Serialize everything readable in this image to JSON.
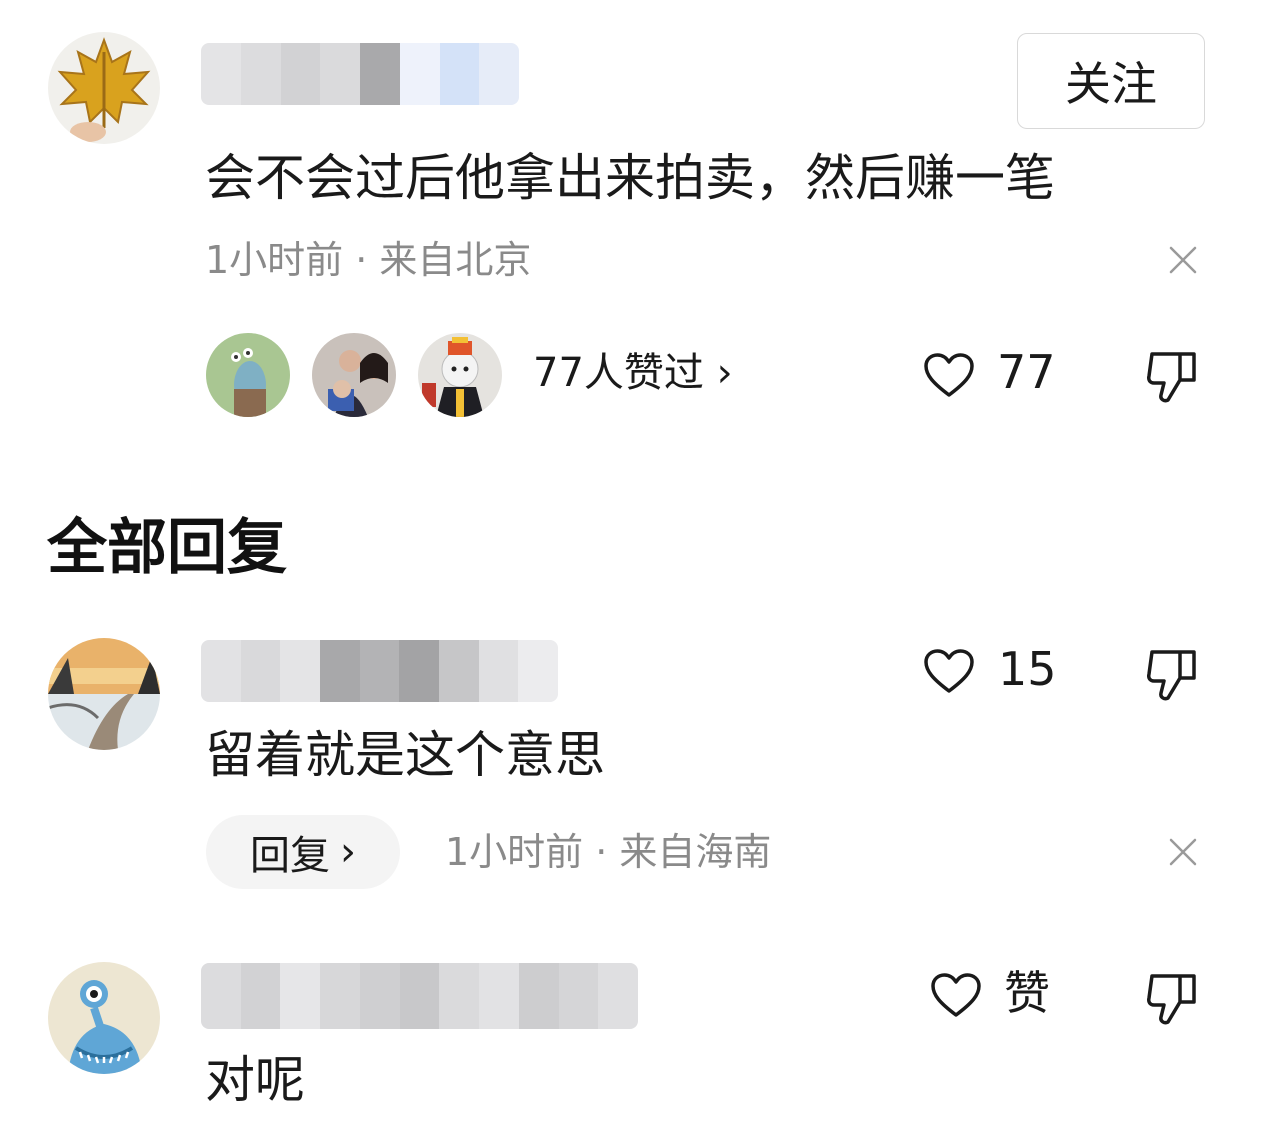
{
  "comment": {
    "follow_label": "关注",
    "text": "会不会过后他拿出来拍卖，然后赚一笔",
    "meta": "1小时前 · 来自北京",
    "likers_text": "77人赞过 ›",
    "like_count": "77"
  },
  "section_title": "全部回复",
  "replies": [
    {
      "text": "留着就是这个意思",
      "like_count": "15",
      "reply_label": "回复",
      "reply_chevron": "›",
      "meta": "1小时前 · 来自海南"
    },
    {
      "text": "对呢",
      "like_label": "赞"
    }
  ],
  "icons": {
    "like": "heart-outline-icon",
    "dislike": "thumbs-down-icon",
    "close": "close-icon"
  },
  "colors": {
    "text": "#1a1a1a",
    "meta": "#8a8a8a",
    "pill_bg": "#f4f4f4",
    "border": "#d9d9d9"
  }
}
